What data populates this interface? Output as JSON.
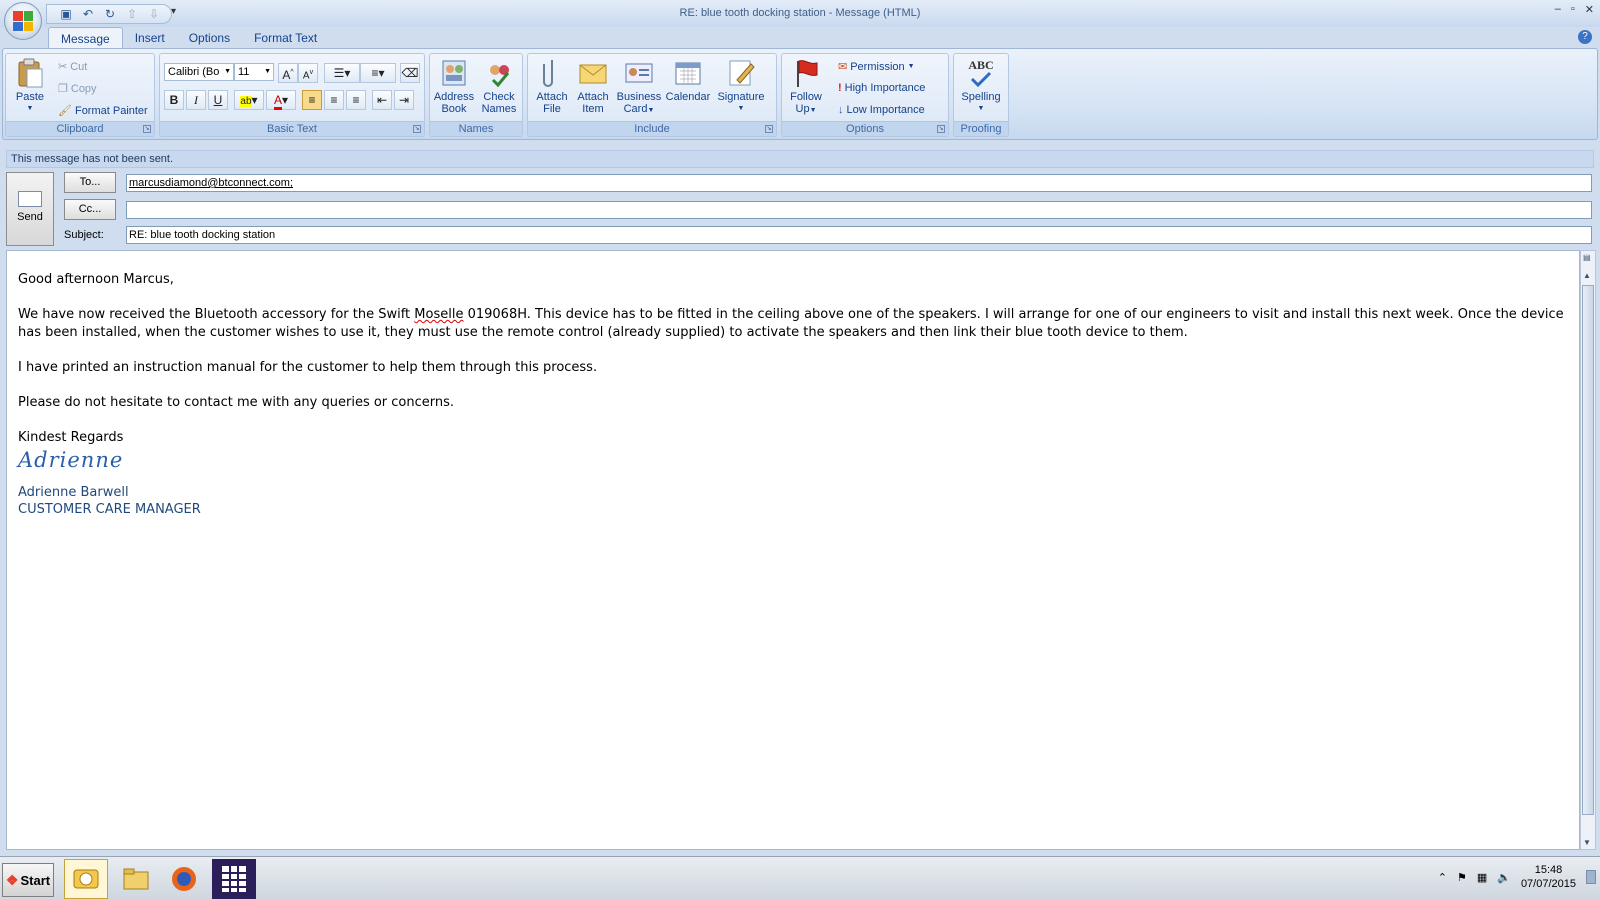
{
  "window": {
    "title": "RE: blue tooth docking station - Message (HTML)",
    "controls": [
      "–",
      "▫",
      "✕"
    ]
  },
  "tabs": [
    "Message",
    "Insert",
    "Options",
    "Format Text"
  ],
  "ribbon": {
    "clipboard": {
      "label": "Clipboard",
      "paste": "Paste",
      "cut": "Cut",
      "copy": "Copy",
      "format_painter": "Format Painter"
    },
    "basic_text": {
      "label": "Basic Text",
      "font": "Calibri (Bo",
      "size": "11"
    },
    "names": {
      "label": "Names",
      "address_book": [
        "Address",
        "Book"
      ],
      "check_names": [
        "Check",
        "Names"
      ]
    },
    "include": {
      "label": "Include",
      "attach_file": [
        "Attach",
        "File"
      ],
      "attach_item": [
        "Attach",
        "Item"
      ],
      "business_card": [
        "Business",
        "Card"
      ],
      "calendar": "Calendar",
      "signature": "Signature"
    },
    "options": {
      "label": "Options",
      "follow_up": [
        "Follow",
        "Up"
      ],
      "permission": "Permission",
      "high_importance": "High Importance",
      "low_importance": "Low Importance"
    },
    "proofing": {
      "label": "Proofing",
      "spelling": "Spelling",
      "abc": "ABC"
    }
  },
  "infobar": "This message has not been sent.",
  "header": {
    "send_label": "Send",
    "to_button": "To...",
    "cc_button": "Cc...",
    "subject_label": "Subject:",
    "to_value": "marcusdiamond@btconnect.com;",
    "cc_value": "",
    "subject_value": "RE: blue tooth docking station"
  },
  "body": {
    "greeting": "Good afternoon Marcus,",
    "para1_a": "We have now received the Bluetooth accessory for the Swift ",
    "para1_misspelled": "Moselle",
    "para1_b": " 019068H.    This device has to be fitted in the ceiling above one of the speakers.    I will arrange for one of our engineers to visit and install this next week.  Once the device has been installed, when the customer wishes to use it, they must use the remote control (already supplied) to activate the speakers and then link their blue tooth device to them.",
    "para2": "I have printed an instruction manual for the customer to help them through this process.",
    "para3": "Please do not hesitate to contact me with any queries or concerns.",
    "closing": "Kindest Regards",
    "signature_script": "Adrienne",
    "signature_name": "Adrienne Barwell",
    "signature_title": "CUSTOMER CARE MANAGER"
  },
  "taskbar": {
    "start": "Start",
    "apps": [
      "outlook-icon",
      "file-explorer-icon",
      "firefox-icon",
      "calculator-icon"
    ],
    "time": "15:48",
    "date": "07/07/2015"
  },
  "colors": {
    "ribbon_bg": "#d3e2f4",
    "ribbon_text": "#15428b",
    "signature_blue": "#1f497d"
  }
}
